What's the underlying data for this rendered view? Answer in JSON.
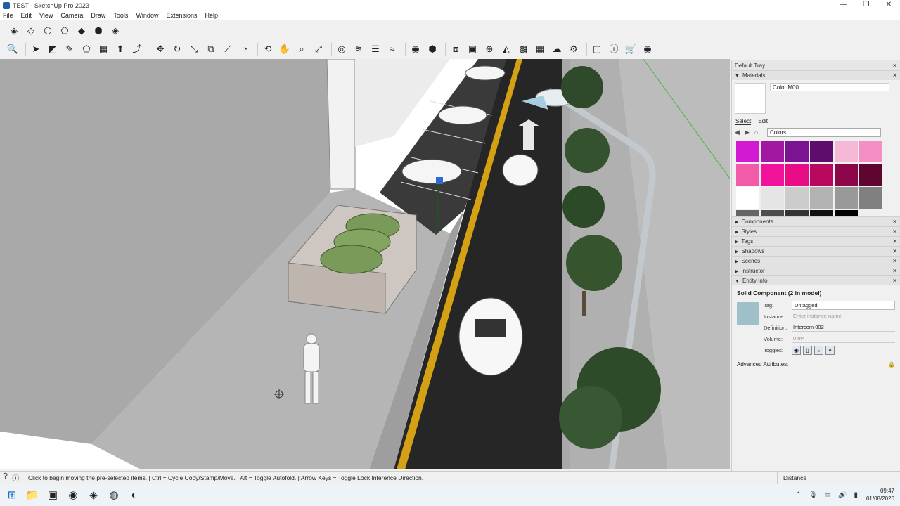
{
  "window": {
    "title": "TEST - SketchUp Pro 2023",
    "controls": [
      "—",
      "❐",
      "✕"
    ]
  },
  "menu": [
    "File",
    "Edit",
    "View",
    "Camera",
    "Draw",
    "Tools",
    "Window",
    "Extensions",
    "Help"
  ],
  "toolbar_views": [
    {
      "icon": "iso-view-icon",
      "glyph": "◈"
    },
    {
      "icon": "top-view-icon",
      "glyph": "◇"
    },
    {
      "icon": "front-view-icon",
      "glyph": "⬡"
    },
    {
      "icon": "right-view-icon",
      "glyph": "⬠"
    },
    {
      "icon": "back-view-icon",
      "glyph": "◆"
    },
    {
      "icon": "left-view-icon",
      "glyph": "⬢"
    },
    {
      "icon": "bottom-view-icon",
      "glyph": "◈"
    }
  ],
  "toolbar_tools": [
    {
      "icon": "zoom-icon",
      "glyph": "🔍"
    },
    {
      "icon": "select-icon",
      "glyph": "➤"
    },
    {
      "icon": "eraser-icon",
      "glyph": "◩"
    },
    {
      "icon": "pencil-icon",
      "glyph": "✎"
    },
    {
      "icon": "shape-icon",
      "glyph": "⬠"
    },
    {
      "icon": "paint-bucket-icon",
      "glyph": "▦"
    },
    {
      "icon": "push-pull-icon",
      "glyph": "⬆"
    },
    {
      "icon": "follow-me-icon",
      "glyph": "⤴"
    },
    {
      "icon": "move-icon",
      "glyph": "✥"
    },
    {
      "icon": "rotate-icon",
      "glyph": "↻"
    },
    {
      "icon": "scale-icon",
      "glyph": "⤡"
    },
    {
      "icon": "offset-icon",
      "glyph": "⧉"
    },
    {
      "icon": "tape-measure-icon",
      "glyph": "⟋"
    },
    {
      "icon": "protractor-icon",
      "glyph": "◔"
    },
    {
      "icon": "orbit-icon",
      "glyph": "⟲"
    },
    {
      "icon": "pan-icon",
      "glyph": "✋"
    },
    {
      "icon": "zoom-tool-icon",
      "glyph": "⌕"
    },
    {
      "icon": "zoom-extents-icon",
      "glyph": "⤢"
    },
    {
      "icon": "section-plane-icon",
      "glyph": "◎"
    },
    {
      "icon": "section-fill-icon",
      "glyph": "≋"
    },
    {
      "icon": "layers-icon",
      "glyph": "☰"
    },
    {
      "icon": "display-section-icon",
      "glyph": "≈"
    },
    {
      "icon": "account-icon",
      "glyph": "◉"
    },
    {
      "icon": "warehouse-icon",
      "glyph": "⬢"
    },
    {
      "icon": "extension-icon",
      "glyph": "⧈"
    },
    {
      "icon": "solid-tools-icon",
      "glyph": "▣"
    },
    {
      "icon": "add-location-icon",
      "glyph": "⊕"
    },
    {
      "icon": "geo-icon",
      "glyph": "◭"
    },
    {
      "icon": "photo-texture-icon",
      "glyph": "▩"
    },
    {
      "icon": "grid-icon",
      "glyph": "▦"
    },
    {
      "icon": "cloud-icon",
      "glyph": "☁"
    },
    {
      "icon": "settings-icon",
      "glyph": "⚙"
    },
    {
      "icon": "layout-icon",
      "glyph": "▢"
    },
    {
      "icon": "info-icon",
      "glyph": "ⓘ"
    },
    {
      "icon": "cart-icon",
      "glyph": "🛒"
    },
    {
      "icon": "profile-icon",
      "glyph": "◉"
    }
  ],
  "tray": {
    "title": "Default Tray",
    "materials": {
      "header": "Materials",
      "name": "Color M00",
      "tab_select": "Select",
      "tab_edit": "Edit",
      "library": "Colors",
      "swatches": [
        "#d21ad2",
        "#a318a3",
        "#7b1490",
        "#5e0d6e",
        "#f5b8d5",
        "#f58ec2",
        "#f25ba8",
        "#f0129b",
        "#e80c86",
        "#b8095f",
        "#8c064a",
        "#5e0530",
        "#ffffff",
        "#e5e5e5",
        "#cccccc",
        "#b3b3b3",
        "#999999",
        "#808080",
        "#666666",
        "#4d4d4d",
        "#333333",
        "#111111",
        "#000000",
        "#f0f0f0"
      ]
    },
    "panels": [
      "Components",
      "Styles",
      "Tags",
      "Shadows",
      "Scenes",
      "Instructor"
    ],
    "entity_info": {
      "header": "Entity Info",
      "title": "Solid Component (2 in model)",
      "tag_label": "Tag:",
      "tag_value": "Untagged",
      "instance_label": "Instance:",
      "instance_placeholder": "Enter instance name",
      "definition_label": "Definition:",
      "definition_value": "Intercom 002",
      "volume_label": "Volume:",
      "volume_value": "0 m³",
      "toggles_label": "Toggles:",
      "advanced": "Advanced Attributes:"
    }
  },
  "status": {
    "text": "Click to begin moving the pre-selected items.  |  Ctrl = Cycle Copy/Stamp/Move.  |  Alt = Toggle Autofold.  |  Arrow Keys = Toggle Lock Inference Direction.",
    "distance_label": "Distance"
  },
  "taskbar": {
    "apps": [
      {
        "icon": "windows-start-icon",
        "glyph": "⊞"
      },
      {
        "icon": "file-explorer-icon",
        "glyph": "📁"
      },
      {
        "icon": "screen-recorder-icon",
        "glyph": "▣"
      },
      {
        "icon": "github-icon",
        "glyph": "◉"
      },
      {
        "icon": "sketchup-icon",
        "glyph": "◈"
      },
      {
        "icon": "chrome-icon",
        "glyph": "◍"
      },
      {
        "icon": "discord-icon",
        "glyph": "◐"
      }
    ],
    "time": "09:47",
    "date": "01/08/2026"
  },
  "colors": {
    "accent": "#0b5fb5",
    "road": "#262626",
    "yellow_line": "#d4a114",
    "floor": "#b4b4b4"
  }
}
